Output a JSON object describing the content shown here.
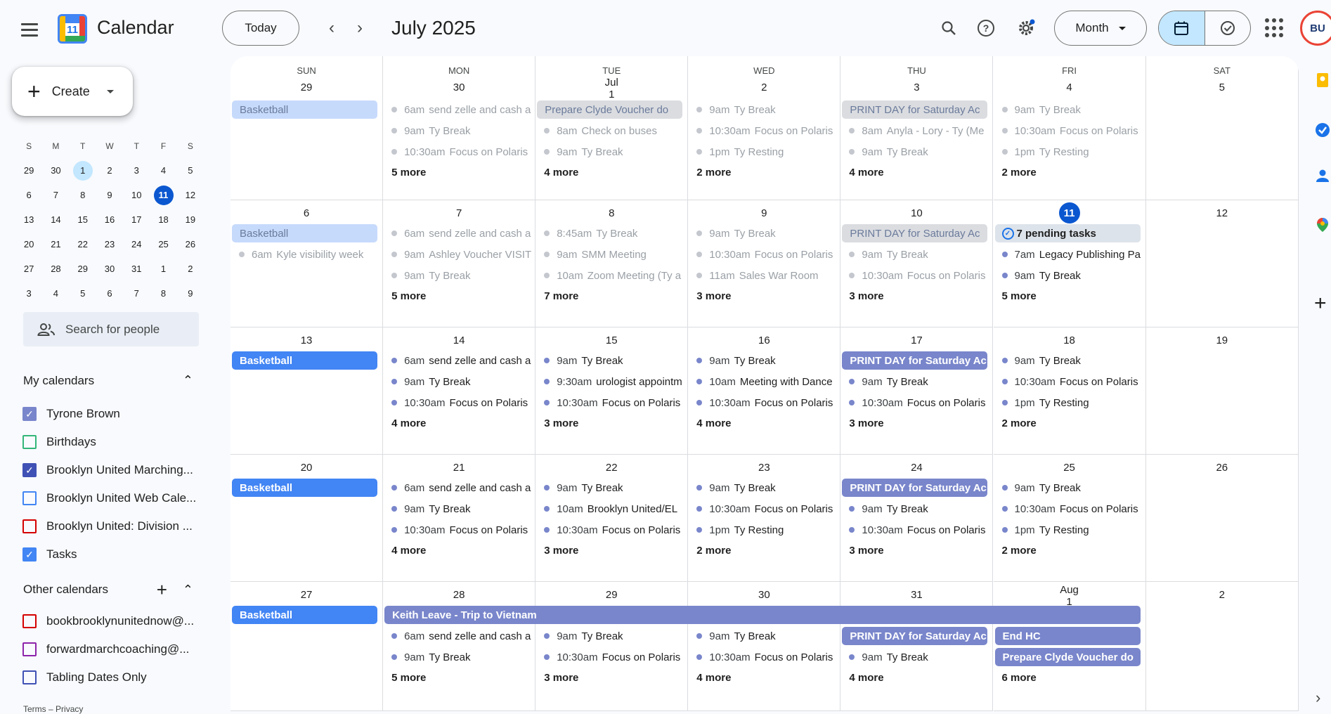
{
  "app": {
    "title": "Calendar",
    "logo_day": "11"
  },
  "toolbar": {
    "today_label": "Today",
    "month_title": "July 2025",
    "view_label": "Month"
  },
  "create": {
    "label": "Create"
  },
  "mini_cal": {
    "dows": [
      "S",
      "M",
      "T",
      "W",
      "T",
      "F",
      "S"
    ],
    "weeks": [
      [
        "29",
        "30",
        "1",
        "2",
        "3",
        "4",
        "5"
      ],
      [
        "6",
        "7",
        "8",
        "9",
        "10",
        "11",
        "12"
      ],
      [
        "13",
        "14",
        "15",
        "16",
        "17",
        "18",
        "19"
      ],
      [
        "20",
        "21",
        "22",
        "23",
        "24",
        "25",
        "26"
      ],
      [
        "27",
        "28",
        "29",
        "30",
        "31",
        "1",
        "2"
      ],
      [
        "3",
        "4",
        "5",
        "6",
        "7",
        "8",
        "9"
      ]
    ]
  },
  "search_people": {
    "placeholder": "Search for people"
  },
  "my_calendars": {
    "title": "My calendars",
    "items": [
      {
        "label": "Tyrone Brown",
        "color": "#7986cb",
        "checked": true
      },
      {
        "label": "Birthdays",
        "color": "#33b679",
        "checked": false
      },
      {
        "label": "Brooklyn United Marching...",
        "color": "#3f51b5",
        "checked": true
      },
      {
        "label": "Brooklyn United Web Cale...",
        "color": "#4285f4",
        "checked": false
      },
      {
        "label": "Brooklyn United: Division ...",
        "color": "#d50000",
        "checked": false
      },
      {
        "label": "Tasks",
        "color": "#4285f4",
        "checked": true
      }
    ]
  },
  "other_calendars": {
    "title": "Other calendars",
    "items": [
      {
        "label": "bookbrooklynunitednow@...",
        "color": "#d50000",
        "checked": false
      },
      {
        "label": "forwardmarchcoaching@...",
        "color": "#8e24aa",
        "checked": false
      },
      {
        "label": "Tabling Dates Only",
        "color": "#3f51b5",
        "checked": false
      }
    ]
  },
  "footer": {
    "terms": "Terms",
    "sep": "–",
    "privacy": "Privacy"
  },
  "grid": {
    "dows": [
      "SUN",
      "MON",
      "TUE",
      "WED",
      "THU",
      "FRI",
      "SAT"
    ],
    "weeks": [
      {
        "dates": [
          "29",
          "30",
          "Jul 1",
          "2",
          "3",
          "4",
          "5"
        ],
        "past": true,
        "days": [
          {
            "chips": [
              {
                "label": "Basketball",
                "kind": "blue"
              }
            ],
            "events": [],
            "more": ""
          },
          {
            "chips": [],
            "events": [
              {
                "t": "6am",
                "ttl": "send zelle and cash a"
              },
              {
                "t": "9am",
                "ttl": "Ty Break"
              },
              {
                "t": "10:30am",
                "ttl": "Focus on Polaris"
              }
            ],
            "more": "5 more"
          },
          {
            "chips": [
              {
                "label": "Prepare Clyde Voucher do",
                "kind": "purple"
              }
            ],
            "events": [
              {
                "t": "8am",
                "ttl": "Check on buses"
              },
              {
                "t": "9am",
                "ttl": "Ty Break"
              }
            ],
            "more": "4 more"
          },
          {
            "chips": [],
            "events": [
              {
                "t": "9am",
                "ttl": "Ty Break"
              },
              {
                "t": "10:30am",
                "ttl": "Focus on Polaris"
              },
              {
                "t": "1pm",
                "ttl": "Ty Resting"
              }
            ],
            "more": "2 more"
          },
          {
            "chips": [
              {
                "label": "PRINT DAY for Saturday Ac",
                "kind": "purple"
              }
            ],
            "events": [
              {
                "t": "8am",
                "ttl": "Anyla - Lory - Ty (Me"
              },
              {
                "t": "9am",
                "ttl": "Ty Break"
              }
            ],
            "more": "4 more"
          },
          {
            "chips": [],
            "events": [
              {
                "t": "9am",
                "ttl": "Ty Break"
              },
              {
                "t": "10:30am",
                "ttl": "Focus on Polaris"
              },
              {
                "t": "1pm",
                "ttl": "Ty Resting"
              }
            ],
            "more": "2 more"
          },
          {
            "chips": [],
            "events": [],
            "more": ""
          }
        ]
      },
      {
        "dates": [
          "6",
          "7",
          "8",
          "9",
          "10",
          "11",
          "12"
        ],
        "past": true,
        "days": [
          {
            "chips": [
              {
                "label": "Basketball",
                "kind": "blue"
              }
            ],
            "events": [
              {
                "t": "6am",
                "ttl": "Kyle visibility week"
              }
            ],
            "more": ""
          },
          {
            "chips": [],
            "events": [
              {
                "t": "6am",
                "ttl": "send zelle and cash a"
              },
              {
                "t": "9am",
                "ttl": "Ashley Voucher VISIT"
              },
              {
                "t": "9am",
                "ttl": "Ty Break"
              }
            ],
            "more": "5 more"
          },
          {
            "chips": [],
            "events": [
              {
                "t": "8:45am",
                "ttl": "Ty Break"
              },
              {
                "t": "9am",
                "ttl": "SMM Meeting"
              },
              {
                "t": "10am",
                "ttl": "Zoom Meeting (Ty a"
              }
            ],
            "more": "7 more"
          },
          {
            "chips": [],
            "events": [
              {
                "t": "9am",
                "ttl": "Ty Break"
              },
              {
                "t": "10:30am",
                "ttl": "Focus on Polaris"
              },
              {
                "t": "11am",
                "ttl": "Sales War Room"
              }
            ],
            "more": "3 more"
          },
          {
            "chips": [
              {
                "label": "PRINT DAY for Saturday Ac",
                "kind": "purple"
              }
            ],
            "events": [
              {
                "t": "9am",
                "ttl": "Ty Break"
              },
              {
                "t": "10:30am",
                "ttl": "Focus on Polaris"
              }
            ],
            "more": "3 more"
          },
          {
            "chips": [
              {
                "label": "7 pending tasks",
                "kind": "tasks"
              }
            ],
            "events": [
              {
                "t": "7am",
                "ttl": "Legacy Publishing Pa",
                "cur": true
              },
              {
                "t": "9am",
                "ttl": "Ty Break",
                "cur": true
              }
            ],
            "more": "5 more"
          },
          {
            "chips": [],
            "events": [],
            "more": ""
          }
        ]
      },
      {
        "dates": [
          "13",
          "14",
          "15",
          "16",
          "17",
          "18",
          "19"
        ],
        "past": false,
        "days": [
          {
            "chips": [
              {
                "label": "Basketball",
                "kind": "blue"
              }
            ],
            "events": [],
            "more": ""
          },
          {
            "chips": [],
            "events": [
              {
                "t": "6am",
                "ttl": "send zelle and cash a"
              },
              {
                "t": "9am",
                "ttl": "Ty Break"
              },
              {
                "t": "10:30am",
                "ttl": "Focus on Polaris"
              }
            ],
            "more": "4 more"
          },
          {
            "chips": [],
            "events": [
              {
                "t": "9am",
                "ttl": "Ty Break"
              },
              {
                "t": "9:30am",
                "ttl": "urologist appointm"
              },
              {
                "t": "10:30am",
                "ttl": "Focus on Polaris"
              }
            ],
            "more": "3 more"
          },
          {
            "chips": [],
            "events": [
              {
                "t": "9am",
                "ttl": "Ty Break"
              },
              {
                "t": "10am",
                "ttl": "Meeting with Dance"
              },
              {
                "t": "10:30am",
                "ttl": "Focus on Polaris"
              }
            ],
            "more": "4 more"
          },
          {
            "chips": [
              {
                "label": "PRINT DAY for Saturday Ac",
                "kind": "purple"
              }
            ],
            "events": [
              {
                "t": "9am",
                "ttl": "Ty Break"
              },
              {
                "t": "10:30am",
                "ttl": "Focus on Polaris"
              }
            ],
            "more": "3 more"
          },
          {
            "chips": [],
            "events": [
              {
                "t": "9am",
                "ttl": "Ty Break"
              },
              {
                "t": "10:30am",
                "ttl": "Focus on Polaris"
              },
              {
                "t": "1pm",
                "ttl": "Ty Resting"
              }
            ],
            "more": "2 more"
          },
          {
            "chips": [],
            "events": [],
            "more": ""
          }
        ]
      },
      {
        "dates": [
          "20",
          "21",
          "22",
          "23",
          "24",
          "25",
          "26"
        ],
        "past": false,
        "days": [
          {
            "chips": [
              {
                "label": "Basketball",
                "kind": "blue"
              }
            ],
            "events": [],
            "more": ""
          },
          {
            "chips": [],
            "events": [
              {
                "t": "6am",
                "ttl": "send zelle and cash a"
              },
              {
                "t": "9am",
                "ttl": "Ty Break"
              },
              {
                "t": "10:30am",
                "ttl": "Focus on Polaris"
              }
            ],
            "more": "4 more"
          },
          {
            "chips": [],
            "events": [
              {
                "t": "9am",
                "ttl": "Ty Break"
              },
              {
                "t": "10am",
                "ttl": "Brooklyn United/EL"
              },
              {
                "t": "10:30am",
                "ttl": "Focus on Polaris"
              }
            ],
            "more": "3 more"
          },
          {
            "chips": [],
            "events": [
              {
                "t": "9am",
                "ttl": "Ty Break"
              },
              {
                "t": "10:30am",
                "ttl": "Focus on Polaris"
              },
              {
                "t": "1pm",
                "ttl": "Ty Resting"
              }
            ],
            "more": "2 more"
          },
          {
            "chips": [
              {
                "label": "PRINT DAY for Saturday Ac",
                "kind": "purple"
              }
            ],
            "events": [
              {
                "t": "9am",
                "ttl": "Ty Break"
              },
              {
                "t": "10:30am",
                "ttl": "Focus on Polaris"
              }
            ],
            "more": "3 more"
          },
          {
            "chips": [],
            "events": [
              {
                "t": "9am",
                "ttl": "Ty Break"
              },
              {
                "t": "10:30am",
                "ttl": "Focus on Polaris"
              },
              {
                "t": "1pm",
                "ttl": "Ty Resting"
              }
            ],
            "more": "2 more"
          },
          {
            "chips": [],
            "events": [],
            "more": ""
          }
        ]
      },
      {
        "dates": [
          "27",
          "28",
          "29",
          "30",
          "31",
          "Aug 1",
          "2"
        ],
        "past": false,
        "span": {
          "label": "Keith Leave - Trip to Vietnam",
          "from": 1,
          "to": 5
        },
        "days": [
          {
            "chips": [
              {
                "label": "Basketball",
                "kind": "blue"
              }
            ],
            "events": [],
            "more": ""
          },
          {
            "chips": [],
            "events": [
              {
                "t": "6am",
                "ttl": "send zelle and cash a"
              },
              {
                "t": "9am",
                "ttl": "Ty Break"
              }
            ],
            "more": "5 more"
          },
          {
            "chips": [],
            "events": [
              {
                "t": "9am",
                "ttl": "Ty Break"
              },
              {
                "t": "10:30am",
                "ttl": "Focus on Polaris"
              }
            ],
            "more": "3 more"
          },
          {
            "chips": [],
            "events": [
              {
                "t": "9am",
                "ttl": "Ty Break"
              },
              {
                "t": "10:30am",
                "ttl": "Focus on Polaris"
              }
            ],
            "more": "4 more"
          },
          {
            "chips": [
              {
                "label": "PRINT DAY for Saturday Ac",
                "kind": "purple"
              }
            ],
            "events": [
              {
                "t": "9am",
                "ttl": "Ty Break"
              }
            ],
            "more": "4 more"
          },
          {
            "chips": [
              {
                "label": "End HC",
                "kind": "purple"
              },
              {
                "label": "Prepare Clyde Voucher do",
                "kind": "purple"
              }
            ],
            "events": [],
            "more": "6 more"
          },
          {
            "chips": [],
            "events": [],
            "more": ""
          }
        ]
      }
    ]
  },
  "colors": {
    "blue_chip": "#4285f4",
    "blue_chip_past": "#c6dafc",
    "purple_chip": "#7986cb",
    "purple_chip_past": "#dadce0",
    "today_circle": "#0b57d0"
  },
  "user": {
    "avatar_text": "BU"
  }
}
